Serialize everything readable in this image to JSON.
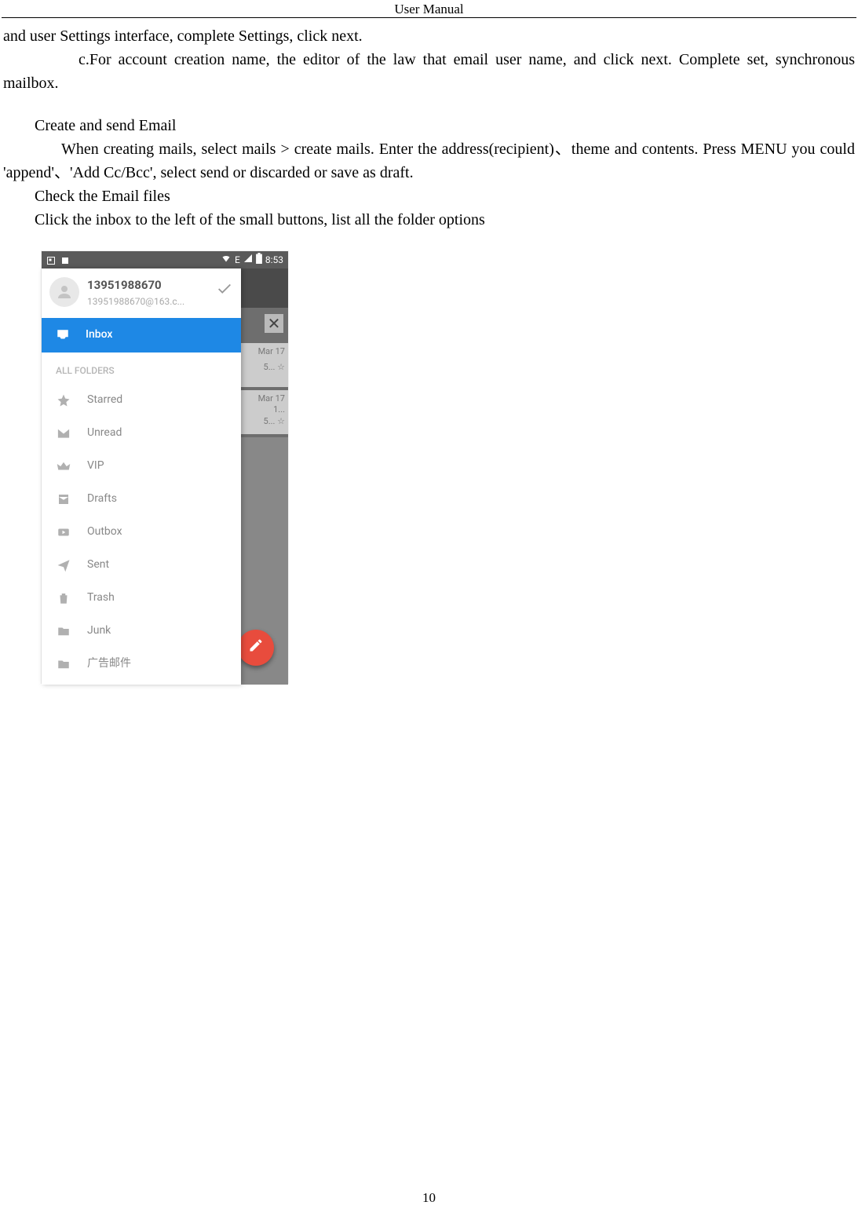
{
  "header": "User    Manual",
  "paragraphs": {
    "p1": "and user Settings interface, complete Settings, click next.",
    "p2": "c.For account creation name, the editor of the law that email user name, and click next. Complete set, synchronous mailbox.",
    "p3": "Create and send Email",
    "p4": "When creating mails, select mails > create mails. Enter the address(recipient)、theme and contents. Press MENU you could 'append'、'Add Cc/Bcc',    select send or discarded or save as draft.",
    "p5a": "Check the Email files",
    "p5b": "Click the inbox to the left of the small buttons, list all the folder options"
  },
  "screenshot": {
    "status": {
      "time": "8:53",
      "signal": "E",
      "triangle": "▲"
    },
    "account": {
      "name": "13951988670",
      "email": "13951988670@163.c..."
    },
    "inbox_label": "Inbox",
    "section_label": "ALL FOLDERS",
    "folders": [
      "Starred",
      "Unread",
      "VIP",
      "Drafts",
      "Outbox",
      "Sent",
      "Trash",
      "Junk",
      "广告邮件"
    ],
    "peek": {
      "date": "Mar 17",
      "frag1": "5...  ☆",
      "frag2": "1...",
      "frag3": "5...  ☆"
    },
    "close": "✕"
  },
  "page_number": "10"
}
